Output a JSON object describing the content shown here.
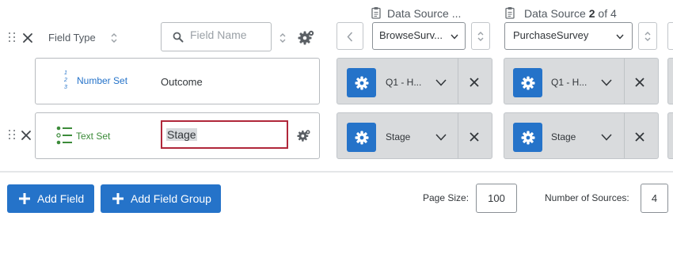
{
  "header": {
    "field_type_label": "Field Type",
    "search": {
      "placeholder": "Field Name",
      "value": ""
    }
  },
  "sources": [
    {
      "title_prefix": "Data Source",
      "title_number": "",
      "title_suffix": "...",
      "selected": "BrowseSurv..."
    },
    {
      "title_prefix": "Data Source",
      "title_number": "2",
      "title_suffix": "of 4",
      "selected": "PurchaseSurvey"
    }
  ],
  "rows": [
    {
      "type_label": "Number Set",
      "type_color": "#2573c9",
      "name": "Outcome",
      "number_icon_digits": [
        "1",
        "2",
        "3"
      ],
      "mappings": [
        "Q1 - H...",
        "Q1 - H..."
      ]
    },
    {
      "type_label": "Text Set",
      "type_color": "#3c8b3a",
      "name": "Stage",
      "mappings": [
        "Stage",
        "Stage"
      ]
    }
  ],
  "footer": {
    "add_field_label": "Add Field",
    "add_field_group_label": "Add Field Group",
    "page_size_label": "Page Size:",
    "page_size_value": "100",
    "num_sources_label": "Number of Sources:",
    "num_sources_value": "4"
  },
  "colors": {
    "accent": "#2573c9",
    "focus_border": "#b0273a",
    "text_set_green": "#3c8b3a"
  },
  "icons": [
    "drag-handle-icon",
    "close-icon",
    "sort-icon",
    "search-icon",
    "gear-icon",
    "clipboard-icon",
    "chevron-left-icon",
    "chevron-down-icon",
    "plus-icon",
    "number-set-icon",
    "text-set-icon"
  ]
}
